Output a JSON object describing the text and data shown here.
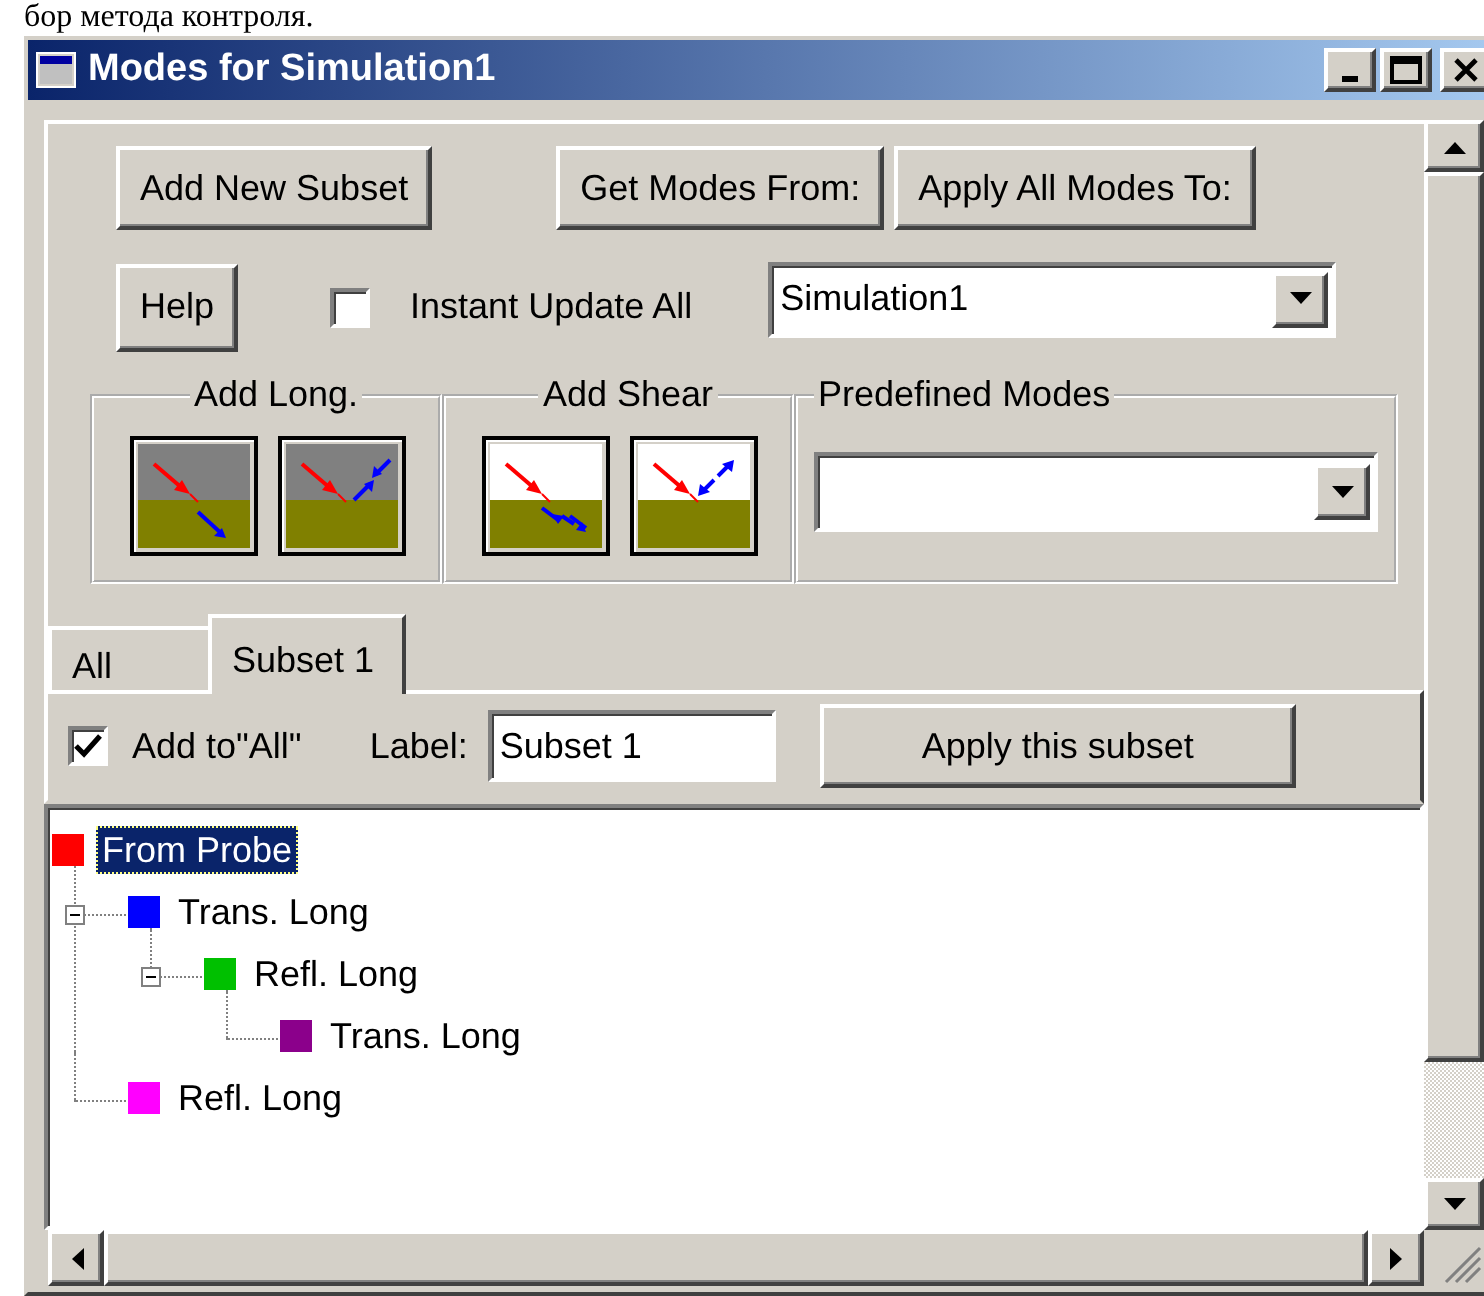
{
  "caption_above": "бор метода контроля.",
  "window": {
    "title": "Modes for Simulation1"
  },
  "top_buttons": [
    "Add New Subset",
    "Get Modes From:",
    "Apply All Modes To:"
  ],
  "help_button": "Help",
  "instant_update_all": {
    "label": "Instant Update All",
    "checked": false
  },
  "simulation_combo": {
    "value": "Simulation1"
  },
  "groups": [
    {
      "title": "Add Long.",
      "kind": "long"
    },
    {
      "title": "Add Shear",
      "kind": "shear"
    },
    {
      "title": "Predefined Modes",
      "kind": "dropdown"
    }
  ],
  "tabs": [
    {
      "label": "All",
      "selected": false
    },
    {
      "label": "Subset 1",
      "selected": true
    }
  ],
  "subset": {
    "add_to_all": {
      "label": "Add to\"All\"",
      "checked": true
    },
    "label_caption": "Label:",
    "label_value": "Subset 1",
    "apply_button": "Apply this subset"
  },
  "tree": [
    {
      "label": "From Probe",
      "color": "#ff0000",
      "selected": true,
      "children": [
        {
          "label": "Trans. Long",
          "color": "#0000ff",
          "selected": false,
          "expanded": true,
          "children": [
            {
              "label": "Refl. Long",
              "color": "#00c000",
              "selected": false,
              "expanded": true,
              "children": [
                {
                  "label": "Trans. Long",
                  "color": "#8b008b",
                  "selected": false
                }
              ]
            }
          ]
        },
        {
          "label": "Refl. Long",
          "color": "#ff00ff",
          "selected": false
        }
      ]
    }
  ]
}
